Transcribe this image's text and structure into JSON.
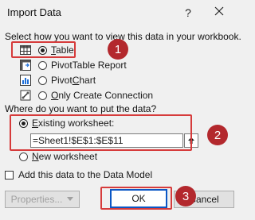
{
  "window": {
    "title": "Import Data",
    "help_label": "?"
  },
  "view_section": {
    "prompt": "Select how you want to view this data in your workbook.",
    "options": [
      {
        "label": "Table",
        "icon": "table-icon",
        "selected": true
      },
      {
        "label": "PivotTable Report",
        "icon": "pivottable-icon",
        "selected": false
      },
      {
        "label": "PivotChart",
        "icon": "pivotchart-icon",
        "selected": false
      },
      {
        "label": "Only Create Connection",
        "icon": "connection-icon",
        "selected": false
      }
    ]
  },
  "location_section": {
    "prompt": "Where do you want to put the data?",
    "existing_label": "Existing worksheet:",
    "existing_selected": true,
    "range_value": "=Sheet1!$E$1:$E$11",
    "new_label": "New worksheet",
    "new_selected": false
  },
  "data_model": {
    "label": "Add this data to the Data Model",
    "checked": false
  },
  "buttons": {
    "properties": "Properties...",
    "ok": "OK",
    "cancel": "Cancel"
  },
  "callouts": {
    "badge_1": "1",
    "badge_2": "2",
    "badge_3": "3"
  },
  "colors": {
    "callout": "#d63b3b",
    "badge": "#b3282d",
    "ok_border": "#0b57c5"
  }
}
